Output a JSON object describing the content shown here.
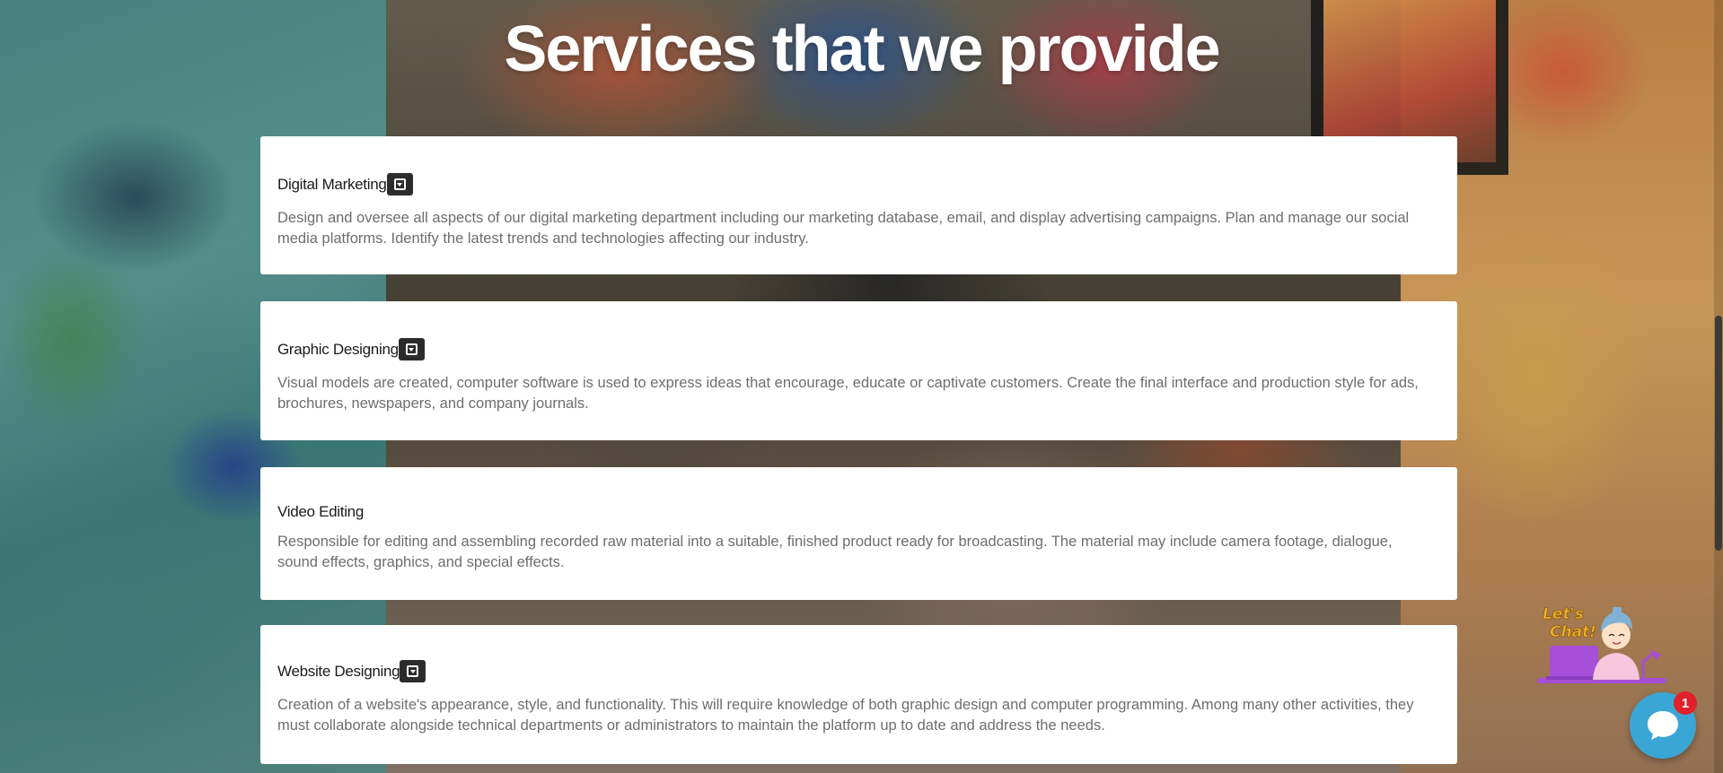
{
  "page": {
    "heading": "Services that we provide"
  },
  "services": [
    {
      "title": "Digital Marketing",
      "has_toggle": true,
      "description": "Design and oversee all aspects of our digital marketing department including our marketing database, email, and display advertising campaigns. Plan and manage our social media platforms. Identify the latest trends and technologies affecting our industry."
    },
    {
      "title": "Graphic Designing",
      "has_toggle": true,
      "description": "Visual models are created, computer software is used to express ideas that encourage, educate or captivate customers. Create the final interface and production style for ads, brochures, newspapers, and company journals."
    },
    {
      "title": "Video Editing",
      "has_toggle": false,
      "description": "Responsible for editing and assembling recorded raw material into a suitable, finished product ready for broadcasting. The material may include camera footage, dialogue, sound effects, graphics, and special effects."
    },
    {
      "title": "Website Designing",
      "has_toggle": true,
      "description": "Creation of a website's appearance, style, and functionality. This will require knowledge of both graphic design and computer programming. Among many other activities, they must collaborate alongside technical departments or administrators to maintain the platform up to date and address the needs."
    }
  ],
  "chat": {
    "promo_label": "Let's Chat!",
    "unread_count": "1",
    "launcher_icon": "chat-bubble-icon"
  },
  "colors": {
    "card_bg": "#ffffff",
    "title_text": "#1a1a1a",
    "desc_text": "#6e6e6e",
    "toggle_bg": "#2c2c2c",
    "chat_blue": "#3aa6d6",
    "badge_red": "#e0202a",
    "promo_purple": "#a64fd8"
  },
  "icons": {
    "toggle": "dropdown-toggle-icon"
  }
}
